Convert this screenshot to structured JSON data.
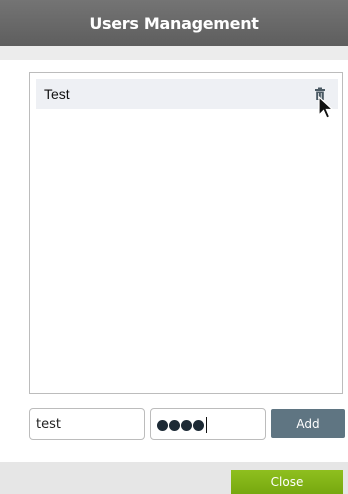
{
  "dialog": {
    "title": "Users Management"
  },
  "users": [
    {
      "name": "Test",
      "delete_icon": "trash-icon"
    }
  ],
  "form": {
    "username_value": "test",
    "password_masked_count": 4,
    "add_label": "Add"
  },
  "footer": {
    "close_label": "Close"
  },
  "colors": {
    "header_bg": "#666666",
    "add_button_bg": "#5f7582",
    "close_button_bg": "#80b31a",
    "list_item_bg": "#eef0f4"
  }
}
